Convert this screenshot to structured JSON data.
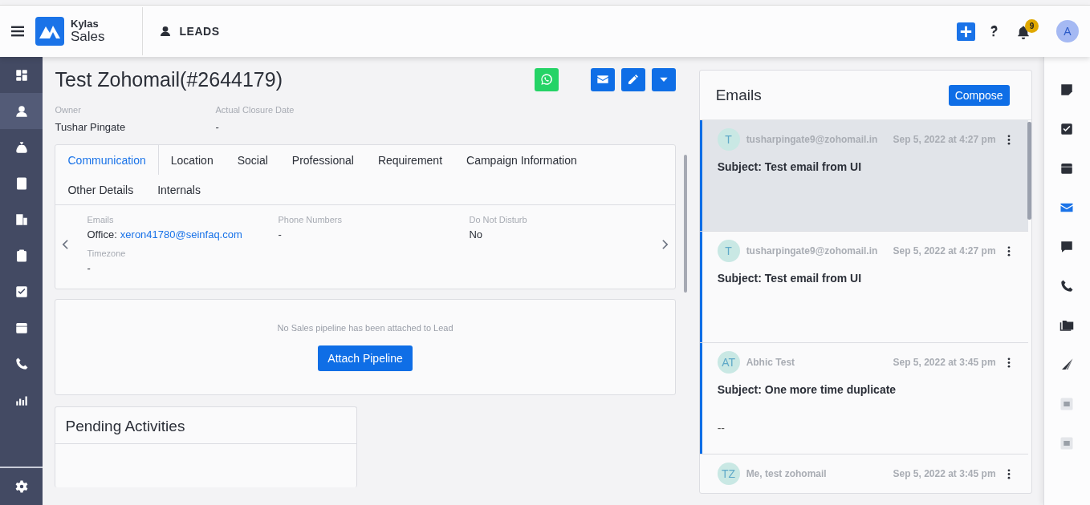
{
  "header": {
    "app_name": "Kylas",
    "app_subtitle": "Sales",
    "module": "LEADS",
    "notification_count": "9",
    "avatar_initial": "A"
  },
  "sidebar": {
    "items": [
      {
        "selected": false
      },
      {
        "selected": true
      },
      {
        "selected": false
      },
      {
        "selected": false
      },
      {
        "selected": false
      },
      {
        "selected": false
      },
      {
        "selected": false
      },
      {
        "selected": false
      },
      {
        "selected": false
      },
      {
        "selected": false
      }
    ]
  },
  "lead": {
    "title": "Test Zohomail(#2644179)",
    "fields": [
      {
        "label": "Owner",
        "value": "Tushar Pingate"
      },
      {
        "label": "Actual Closure Date",
        "value": "-"
      }
    ]
  },
  "tabs": [
    {
      "label": "Communication",
      "selected": true
    },
    {
      "label": "Location",
      "selected": false
    },
    {
      "label": "Social",
      "selected": false
    },
    {
      "label": "Professional",
      "selected": false
    },
    {
      "label": "Requirement",
      "selected": false
    },
    {
      "label": "Campaign Information",
      "selected": false
    },
    {
      "label": "Other Details",
      "selected": false
    },
    {
      "label": "Internals",
      "selected": false
    }
  ],
  "communication": [
    {
      "label": "Emails",
      "prefix": "Office:",
      "link": "xeron41780@seinfaq.com"
    },
    {
      "label": "Phone Numbers",
      "value": "-"
    },
    {
      "label": "Do Not Disturb",
      "value": "No"
    },
    {
      "label": "Timezone",
      "value": "-"
    }
  ],
  "pipeline": {
    "message": "No Sales pipeline has been attached to Lead",
    "button": "Attach Pipeline"
  },
  "pending_activities": {
    "title": "Pending Activities"
  },
  "emails": {
    "title": "Emails",
    "compose": "Compose",
    "items": [
      {
        "initials": "T",
        "sender": "tusharpingate9@zohomail.in",
        "date": "Sep 5, 2022 at 4:27 pm",
        "subject": "Subject: Test email from UI",
        "selected": true,
        "unread": true
      },
      {
        "initials": "T",
        "sender": "tusharpingate9@zohomail.in",
        "date": "Sep 5, 2022 at 4:27 pm",
        "subject": "Subject: Test email from UI",
        "selected": false,
        "unread": true
      },
      {
        "initials": "AT",
        "sender": "Abhic Test",
        "date": "Sep 5, 2022 at 3:45 pm",
        "subject": "Subject: One more time duplicate",
        "preview": "--",
        "selected": false,
        "unread": true
      },
      {
        "initials": "TZ",
        "sender": "Me, test zohomail",
        "date": "Sep 5, 2022 at 3:45 pm",
        "selected": false,
        "unread": false
      }
    ]
  },
  "right_rail": {
    "items": [
      {
        "selected": false
      },
      {
        "selected": false
      },
      {
        "selected": false
      },
      {
        "selected": true
      },
      {
        "selected": false
      },
      {
        "selected": false
      },
      {
        "selected": false
      },
      {
        "selected": false
      },
      {
        "selected": false
      },
      {
        "selected": false
      }
    ]
  }
}
